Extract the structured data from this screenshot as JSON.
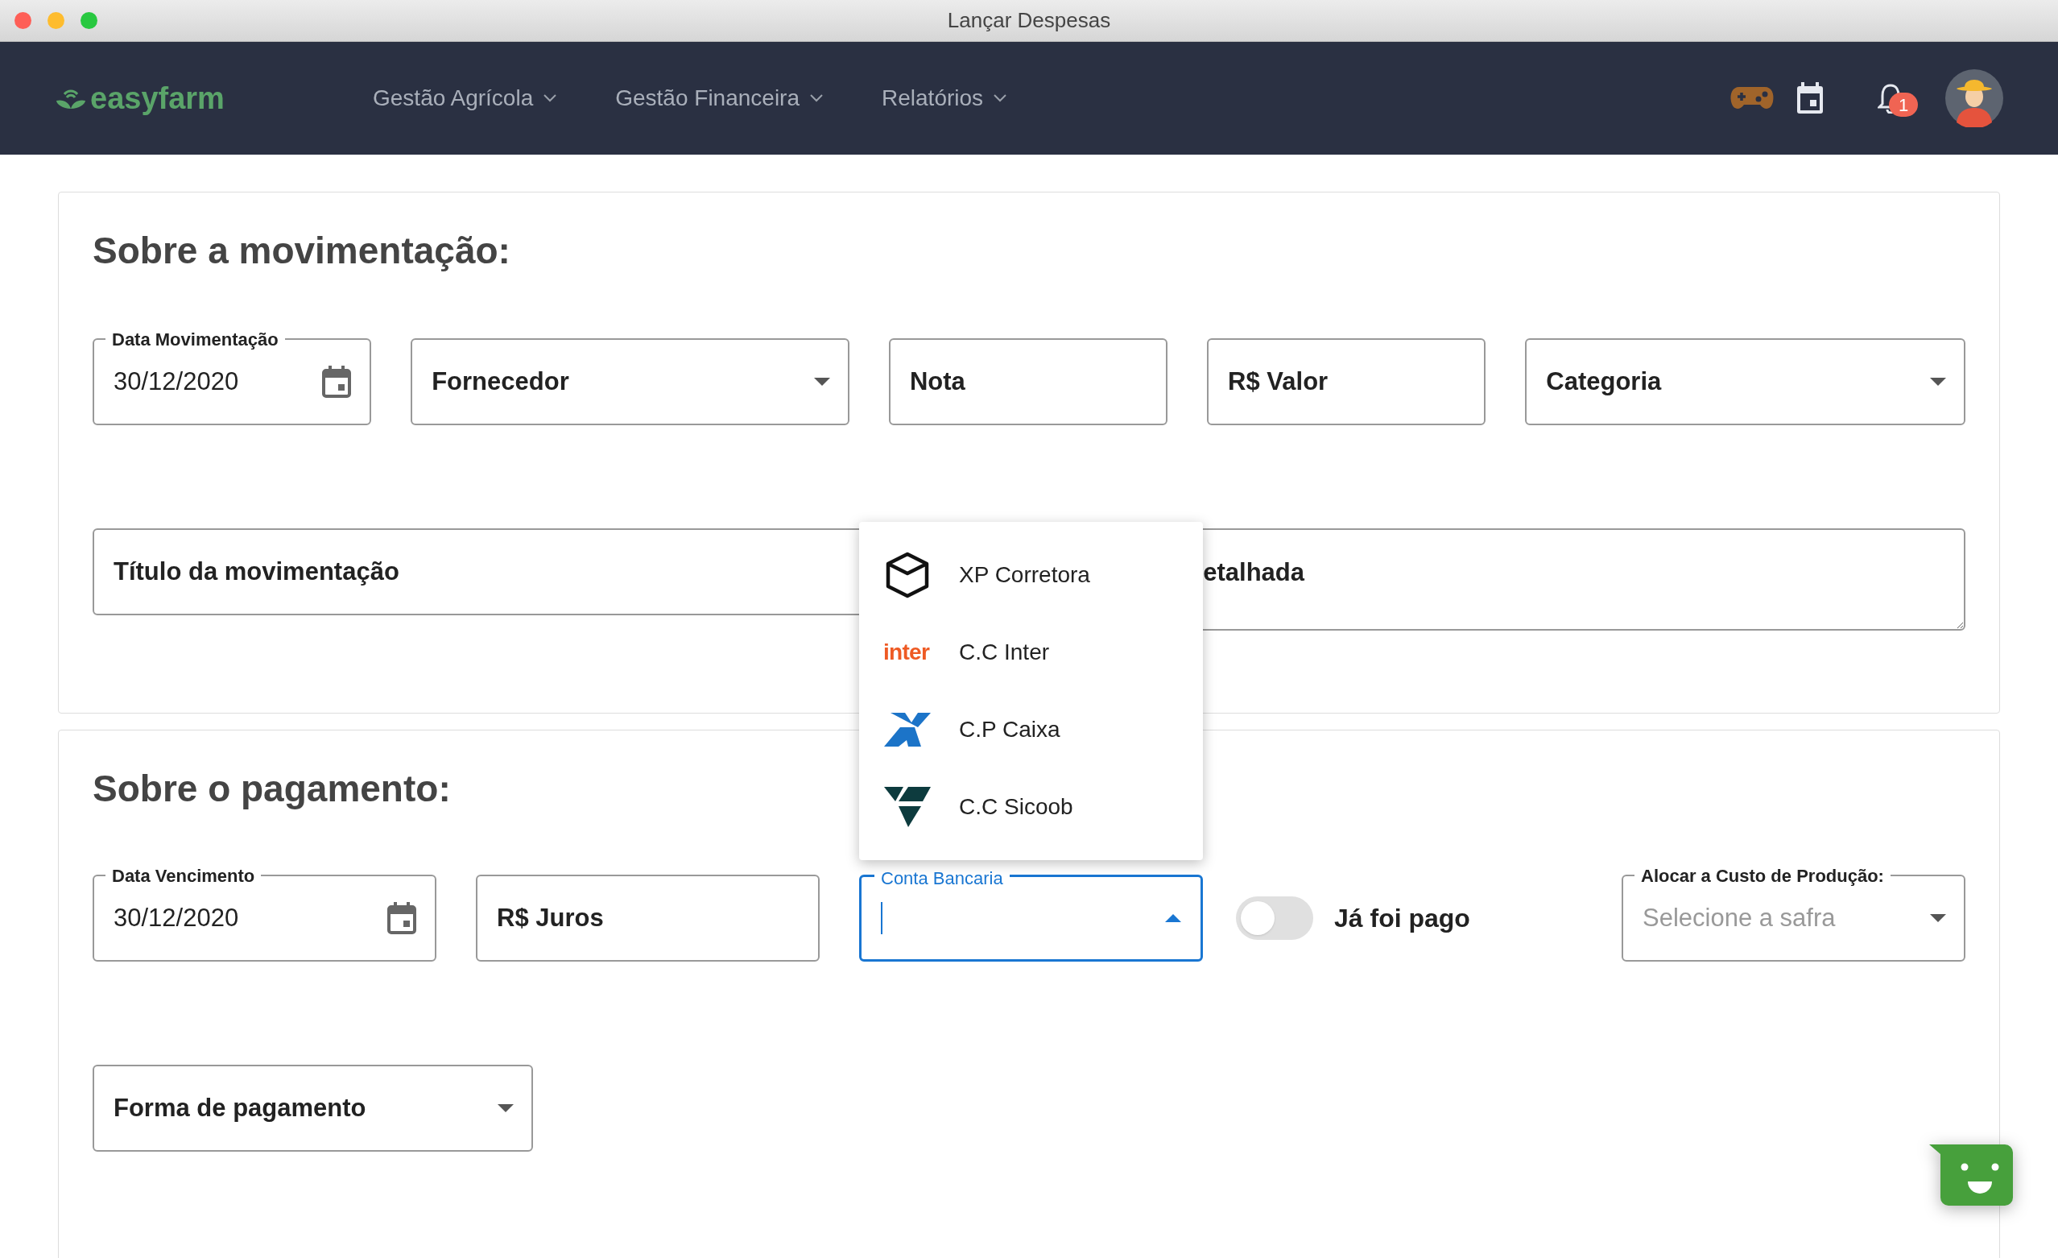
{
  "window": {
    "title": "Lançar Despesas"
  },
  "navbar": {
    "logo": "easyfarm",
    "menu": [
      {
        "label": "Gestão Agrícola"
      },
      {
        "label": "Gestão Financeira"
      },
      {
        "label": "Relatórios"
      }
    ],
    "notification_count": "1"
  },
  "movement_section": {
    "heading": "Sobre a movimentação:",
    "fields": [
      {
        "kind": "date",
        "label": "Data Movimentação",
        "value": "30/12/2020"
      },
      {
        "kind": "select",
        "placeholder": "Fornecedor"
      },
      {
        "kind": "text",
        "placeholder": "Nota"
      },
      {
        "kind": "text",
        "placeholder": "R$ Valor"
      },
      {
        "kind": "select",
        "placeholder": "Categoria"
      }
    ],
    "title_field": {
      "placeholder": "Título da movimentação"
    },
    "description_field": {
      "placeholder": "etalhada"
    }
  },
  "payment_section": {
    "heading": "Sobre o pagamento:",
    "fields": [
      {
        "kind": "date",
        "label": "Data Vencimento",
        "value": "30/12/2020"
      },
      {
        "kind": "text",
        "placeholder": "R$ Juros"
      }
    ],
    "bank_account": {
      "label": "Conta Bancaria",
      "expanded": true,
      "options": [
        {
          "kind": "cube",
          "label": "XP Corretora"
        },
        {
          "kind": "wordmark",
          "logo_text": "inter",
          "label": "C.C Inter"
        },
        {
          "kind": "cross",
          "label": "C.P Caixa"
        },
        {
          "kind": "triangles",
          "label": "C.C Sicoob"
        }
      ]
    },
    "paid_toggle": {
      "label": "Já foi pago",
      "on": false
    },
    "crop_select": {
      "label": "Alocar a Custo de Produção:",
      "placeholder": "Selecione a safra"
    },
    "payment_method": {
      "placeholder": "Forma de pagamento"
    }
  }
}
